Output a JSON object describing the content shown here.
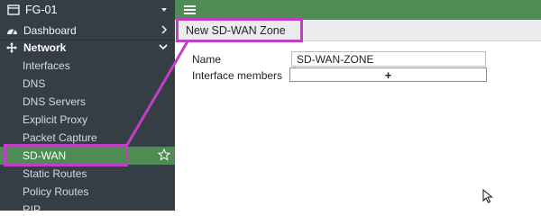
{
  "sidebar": {
    "device": "FG-01",
    "items": [
      {
        "label": "Dashboard"
      },
      {
        "label": "Network"
      },
      {
        "label": "Interfaces"
      },
      {
        "label": "DNS"
      },
      {
        "label": "DNS Servers"
      },
      {
        "label": "Explicit Proxy"
      },
      {
        "label": "Packet Capture"
      },
      {
        "label": "SD-WAN"
      },
      {
        "label": "Static Routes"
      },
      {
        "label": "Policy Routes"
      },
      {
        "label": "RIP"
      }
    ]
  },
  "breadcrumb": {
    "title": "New SD-WAN Zone"
  },
  "form": {
    "name_label": "Name",
    "name_value": "SD-WAN-ZONE",
    "members_label": "Interface members",
    "members_add": "+"
  },
  "colors": {
    "sidebar_bg": "#353d45",
    "accent_green": "#4f8c53",
    "highlight": "#c23ec9"
  }
}
